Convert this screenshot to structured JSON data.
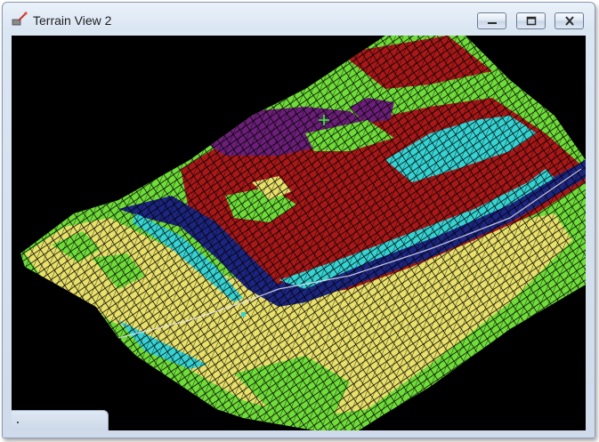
{
  "window": {
    "title": "Terrain View 2",
    "icon": "terrain-tool-icon",
    "controls": [
      "minimize-icon",
      "maximize-icon",
      "close-icon"
    ]
  },
  "viewport": {
    "background": "#000000",
    "band_colors": {
      "green": "#6fdc3a",
      "yellow": "#e8e06a",
      "red": "#a81818",
      "cyan": "#37d3d3",
      "navy": "#1c2580",
      "purple": "#6b1f78",
      "marker": "#2cff2c"
    },
    "cursor": "crosshair-icon"
  }
}
